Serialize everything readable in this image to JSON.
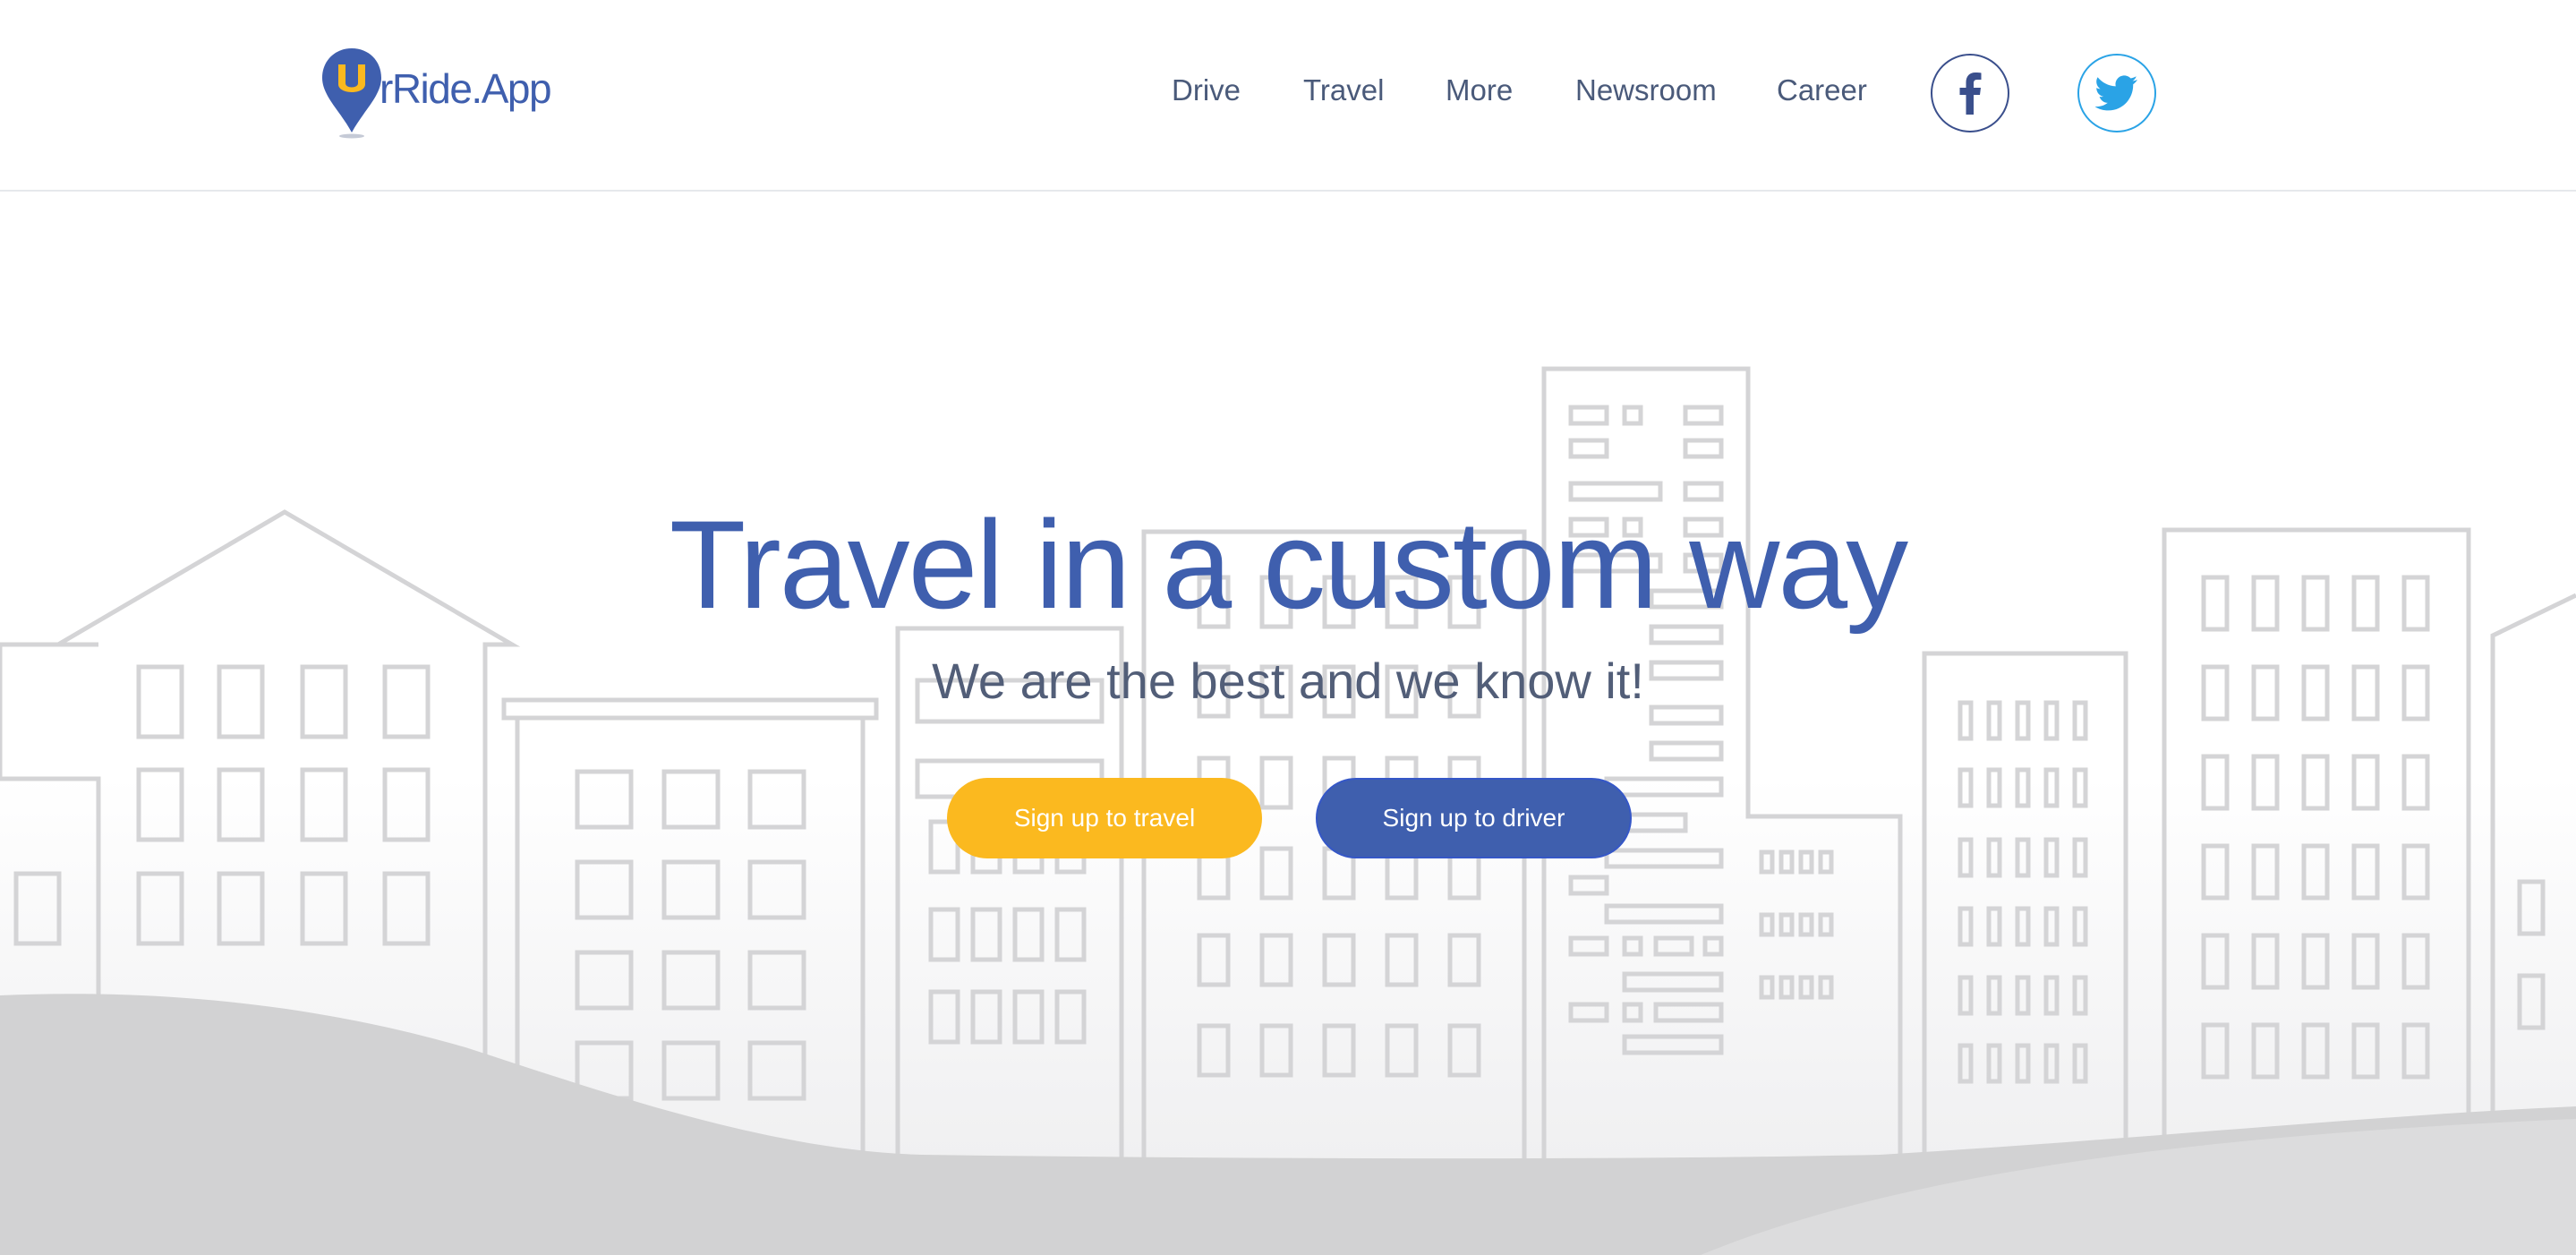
{
  "brand": {
    "logo_letter": "U",
    "logo_text": "rRide.App",
    "colors": {
      "primary": "#3f5fae",
      "accent": "#fbb91f",
      "twitter": "#2aa3e6",
      "facebook": "#3a4f8c"
    }
  },
  "nav": {
    "items": [
      {
        "label": "Drive"
      },
      {
        "label": "Travel"
      },
      {
        "label": "More"
      },
      {
        "label": "Newsroom"
      },
      {
        "label": "Career"
      }
    ],
    "social": [
      {
        "icon": "facebook-icon"
      },
      {
        "icon": "twitter-icon"
      }
    ]
  },
  "hero": {
    "title": "Travel in a custom way",
    "subtitle": "We are the best and we know it!",
    "buttons": {
      "travel_label": "Sign up to travel",
      "driver_label": "Sign up to driver"
    },
    "background": "city-skyline-illustration"
  }
}
